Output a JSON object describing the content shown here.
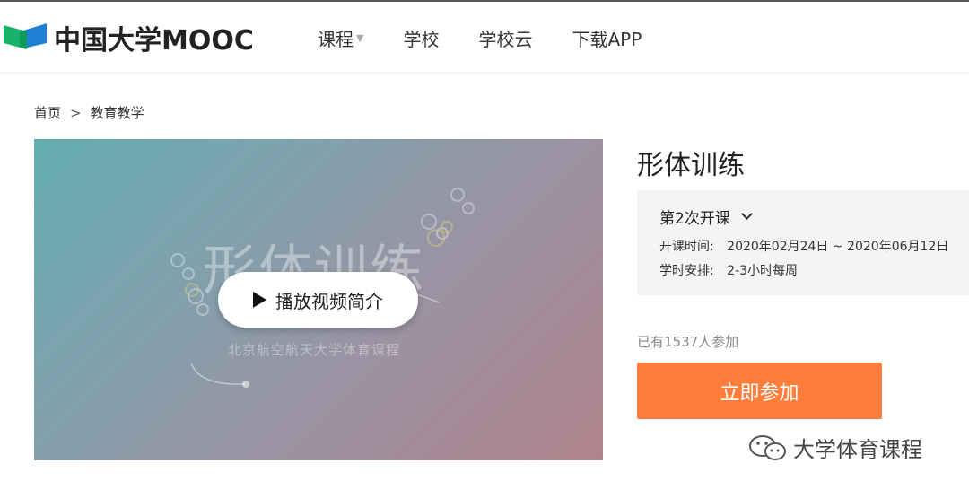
{
  "header": {
    "logo_text": "中国大学MOOC",
    "nav": [
      {
        "label": "课程",
        "has_caret": true
      },
      {
        "label": "学校"
      },
      {
        "label": "学校云"
      },
      {
        "label": "下载APP"
      }
    ]
  },
  "breadcrumb": {
    "home": "首页",
    "separator": ">",
    "current": "教育教学"
  },
  "video": {
    "cover_title": "形体训练",
    "cover_subtitle": "北京航空航天大学体育课程",
    "play_label": "播放视频简介"
  },
  "course": {
    "title": "形体训练",
    "session_label": "第2次开课",
    "time_key": "开课时间:",
    "time_value": "2020年02月24日 ~ 2020年06月12日",
    "hours_key": "学时安排:",
    "hours_value": "2-3小时每周",
    "joined_text": "已有1537人参加",
    "join_button": "立即参加"
  },
  "watermark": {
    "text": "大学体育课程",
    "icon": "wechat-icon"
  },
  "colors": {
    "accent": "#ff7d3b",
    "logo_green": "#17b36b",
    "logo_blue": "#1f80d6"
  }
}
